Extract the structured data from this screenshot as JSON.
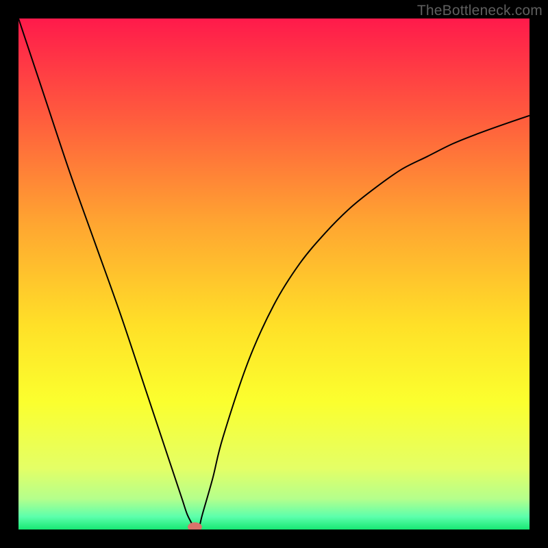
{
  "watermark": "TheBottleneck.com",
  "chart_data": {
    "type": "line",
    "title": "",
    "xlabel": "",
    "ylabel": "",
    "xlim": [
      0,
      100
    ],
    "ylim": [
      0,
      100
    ],
    "grid": false,
    "legend": false,
    "background": "rainbow-vertical-gradient",
    "gradient_stops": [
      {
        "pos": 0.0,
        "color": "#ff1a4b"
      },
      {
        "pos": 0.2,
        "color": "#ff5e3d"
      },
      {
        "pos": 0.4,
        "color": "#ffa531"
      },
      {
        "pos": 0.6,
        "color": "#ffe028"
      },
      {
        "pos": 0.75,
        "color": "#fbff2e"
      },
      {
        "pos": 0.88,
        "color": "#e4ff66"
      },
      {
        "pos": 0.94,
        "color": "#b4ff8c"
      },
      {
        "pos": 0.975,
        "color": "#5cffac"
      },
      {
        "pos": 1.0,
        "color": "#17e873"
      }
    ],
    "series": [
      {
        "name": "bottleneck-curve",
        "stroke": "#000000",
        "stroke_width": 2,
        "x": [
          0,
          5,
          10,
          15,
          20,
          25,
          28,
          30,
          32,
          33,
          34,
          34.5,
          35,
          35.5,
          36,
          38,
          40,
          45,
          50,
          55,
          60,
          65,
          70,
          75,
          80,
          85,
          90,
          95,
          100
        ],
        "values": [
          100,
          85,
          70,
          56,
          42,
          27,
          18,
          12,
          6,
          3,
          1,
          0,
          0,
          1,
          3,
          10,
          18,
          33,
          44,
          52,
          58,
          63,
          67,
          70.5,
          73,
          75.5,
          77.5,
          79.3,
          81
        ]
      }
    ],
    "annotations": [
      {
        "type": "ellipse",
        "name": "bottleneck-marker",
        "cx": 34.5,
        "cy": 0.5,
        "rx": 1.4,
        "ry": 0.9,
        "fill": "#d9736b"
      }
    ]
  }
}
